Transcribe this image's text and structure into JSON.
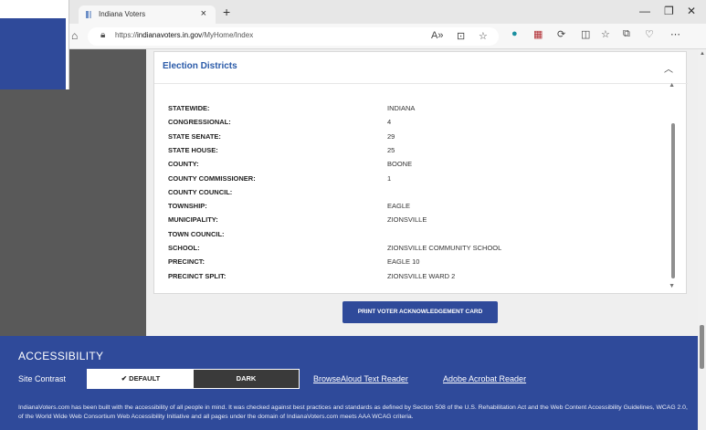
{
  "browser": {
    "tab_title": "Indiana Voters",
    "tab_close": "×",
    "new_tab": "+",
    "url_prefix": "https://",
    "url_domain": "indianavoters.in.gov",
    "url_path": "/MyHome/Index",
    "window_minimize": "—",
    "window_restore": "❐",
    "window_close": "✕"
  },
  "card": {
    "title": "Election Districts",
    "collapse_icon": "chevron-up-icon",
    "districts": [
      {
        "label": "STATEWIDE:",
        "value": "INDIANA"
      },
      {
        "label": "CONGRESSIONAL:",
        "value": "4"
      },
      {
        "label": "STATE SENATE:",
        "value": "29"
      },
      {
        "label": "STATE HOUSE:",
        "value": "25"
      },
      {
        "label": "COUNTY:",
        "value": "BOONE"
      },
      {
        "label": "COUNTY COMMISSIONER:",
        "value": "1"
      },
      {
        "label": "COUNTY COUNCIL:",
        "value": ""
      },
      {
        "label": "TOWNSHIP:",
        "value": "EAGLE"
      },
      {
        "label": "MUNICIPALITY:",
        "value": "ZIONSVILLE"
      },
      {
        "label": "TOWN COUNCIL:",
        "value": ""
      },
      {
        "label": "SCHOOL:",
        "value": "ZIONSVILLE COMMUNITY SCHOOL"
      },
      {
        "label": "PRECINCT:",
        "value": "EAGLE 10"
      },
      {
        "label": "PRECINCT SPLIT:",
        "value": "ZIONSVILLE WARD 2"
      }
    ]
  },
  "print_button": "PRINT VOTER ACKNOWLEDGEMENT CARD",
  "accessibility": {
    "title": "ACCESSIBILITY",
    "contrast_label": "Site Contrast",
    "option_default": "✔ DEFAULT",
    "option_dark": "DARK",
    "link_browsealoud": "BrowseAloud Text Reader",
    "link_acrobat": "Adobe Acrobat Reader",
    "statement": "IndianaVoters.com has been built with the accessibility of all people in mind. It was checked against best practices and standards as defined by Section 508 of the U.S. Rehabilitation Act and the Web Content Accessibility Guidelines, WCAG 2.0, of the World Wide Web Consortium Web Accessibility Initiative and all pages under the domain of IndianaVoters.com meets AAA WCAG criteria."
  },
  "colors": {
    "brand_blue": "#2f4a9a",
    "title_blue": "#2a5aa8",
    "sidebar_gray": "#595959"
  }
}
